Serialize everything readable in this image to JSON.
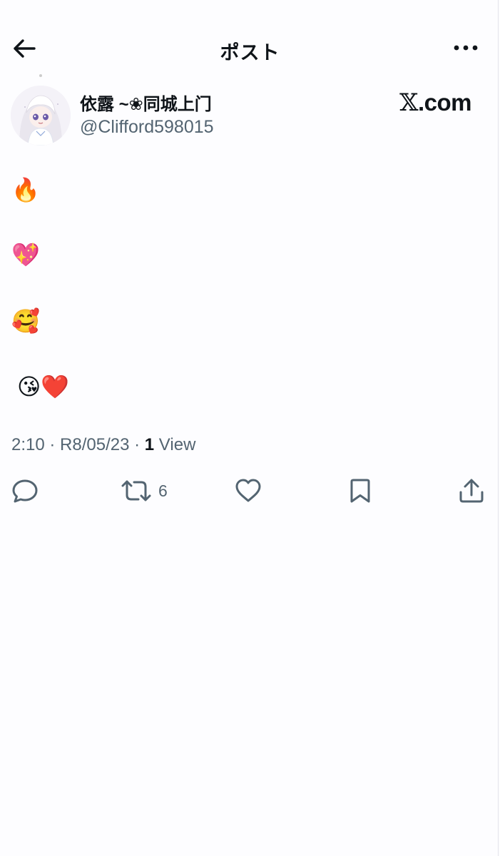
{
  "header": {
    "title": "ポスト",
    "back_icon": "arrow-left-icon",
    "more_icon": "more-horizontal-icon"
  },
  "author": {
    "display_name": "依露 ~❀同城上门",
    "handle": "@Clifford598015",
    "avatar": "avatar-image"
  },
  "watermark": {
    "x_letter": "𝕏",
    "domain_suffix": ".com"
  },
  "post": {
    "lines": [
      "🔥",
      "💖",
      "🥰",
      "😘❤️"
    ]
  },
  "meta": {
    "time": "2:10",
    "sep1": " · ",
    "date": "R8/05/23",
    "sep2": " · ",
    "views_count": "1",
    "views_label": " View"
  },
  "actions": {
    "reply": {
      "icon": "reply-icon"
    },
    "repost": {
      "icon": "repost-icon",
      "count": "6"
    },
    "like": {
      "icon": "heart-icon"
    },
    "bookmark": {
      "icon": "bookmark-icon"
    },
    "share": {
      "icon": "share-icon"
    }
  },
  "colors": {
    "text_primary": "#0f1419",
    "text_secondary": "#536471",
    "background": "#fdfdff"
  }
}
